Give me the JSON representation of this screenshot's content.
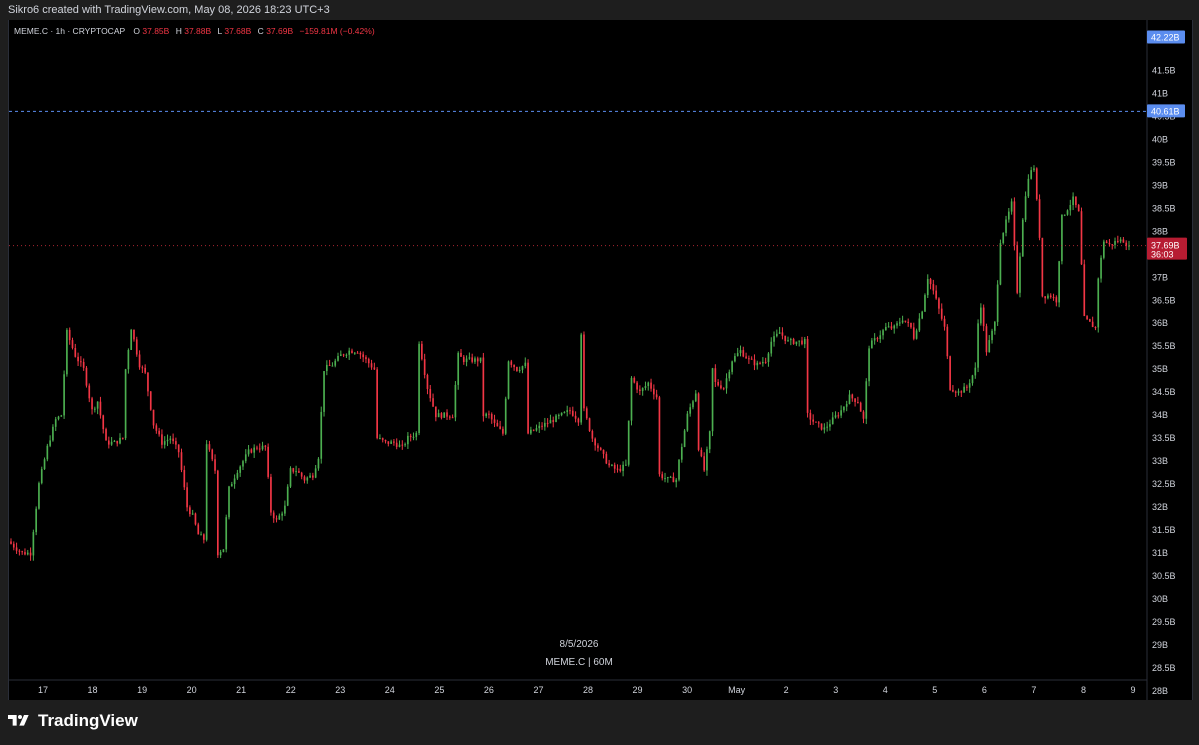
{
  "header": {
    "caption": "Sikro6 created with TradingView.com, May 08, 2026 18:23 UTC+3"
  },
  "legend": {
    "symbol": "MEME.C · 1h · CRYPTOCAP",
    "o_label": "O",
    "o_value": "37.85B",
    "h_label": "H",
    "h_value": "37.88B",
    "l_label": "L",
    "l_value": "37.68B",
    "c_label": "C",
    "c_value": "37.69B",
    "change": "−159.81M (−0.42%)"
  },
  "watermark": {
    "date": "8/5/2026",
    "symbol": "MEME.C | 60M"
  },
  "brand": {
    "name": "TradingView"
  },
  "colors": {
    "up": "#4caf50",
    "down": "#f23645",
    "background": "#000000",
    "axis_text": "#d1d4dc",
    "blue_line": "#5b8def",
    "price_badge": "#b71c32"
  },
  "chart_data": {
    "type": "candlestick",
    "timeframe": "1h",
    "symbol": "MEME.C",
    "y_unit": "B",
    "ylim": [
      27.8,
      42.6
    ],
    "y_ticks": [
      "28B",
      "28.5B",
      "29B",
      "29.5B",
      "30B",
      "30.5B",
      "31B",
      "31.5B",
      "32B",
      "32.5B",
      "33B",
      "33.5B",
      "34B",
      "34.5B",
      "35B",
      "35.5B",
      "36B",
      "36.5B",
      "37B",
      "37.5B",
      "38B",
      "38.5B",
      "39B",
      "39.5B",
      "40B",
      "40.5B",
      "41B",
      "41.5B"
    ],
    "y_tick_values": [
      28,
      28.5,
      29,
      29.5,
      30,
      30.5,
      31,
      31.5,
      32,
      32.5,
      33,
      33.5,
      34,
      34.5,
      35,
      35.5,
      36,
      36.5,
      37,
      37.5,
      38,
      38.5,
      39,
      39.5,
      40,
      40.5,
      41,
      41.5
    ],
    "x_ticks": [
      "17",
      "18",
      "19",
      "20",
      "21",
      "22",
      "23",
      "24",
      "25",
      "26",
      "27",
      "28",
      "29",
      "30",
      "May",
      "2",
      "3",
      "4",
      "5",
      "6",
      "7",
      "8",
      "9"
    ],
    "x_range": [
      "Apr 16 11:00",
      "May 9 02:00"
    ],
    "badges": [
      {
        "label": "42.22B",
        "value": 42.22,
        "style": "blue"
      },
      {
        "label": "40.61B",
        "value": 40.61,
        "style": "blue-line"
      },
      {
        "label": "37.69B",
        "sub": "36:03",
        "value": 37.69,
        "style": "last-price"
      }
    ],
    "close_path": [
      [
        0,
        31.2
      ],
      [
        4,
        31.0
      ],
      [
        7,
        31.0
      ],
      [
        10,
        32.5
      ],
      [
        13,
        33.3
      ],
      [
        16,
        33.9
      ],
      [
        18,
        34.0
      ],
      [
        20,
        35.8
      ],
      [
        23,
        35.3
      ],
      [
        26,
        35.0
      ],
      [
        29,
        34.1
      ],
      [
        31,
        34.3
      ],
      [
        34,
        33.4
      ],
      [
        37,
        33.4
      ],
      [
        40,
        33.5
      ],
      [
        41,
        35.0
      ],
      [
        43,
        35.9
      ],
      [
        46,
        35.1
      ],
      [
        48,
        34.9
      ],
      [
        51,
        33.8
      ],
      [
        54,
        33.4
      ],
      [
        57,
        33.5
      ],
      [
        60,
        33.2
      ],
      [
        63,
        32.0
      ],
      [
        65,
        31.8
      ],
      [
        67,
        31.4
      ],
      [
        69,
        31.3
      ],
      [
        70,
        33.4
      ],
      [
        73,
        32.8
      ],
      [
        74,
        31.0
      ],
      [
        76,
        31.1
      ],
      [
        78,
        32.4
      ],
      [
        81,
        32.8
      ],
      [
        85,
        33.2
      ],
      [
        88,
        33.3
      ],
      [
        91,
        33.3
      ],
      [
        93,
        31.9
      ],
      [
        95,
        31.7
      ],
      [
        98,
        32.0
      ],
      [
        100,
        32.8
      ],
      [
        102,
        32.8
      ],
      [
        105,
        32.6
      ],
      [
        108,
        32.7
      ],
      [
        110,
        33.1
      ],
      [
        112,
        35.0
      ],
      [
        115,
        35.1
      ],
      [
        118,
        35.3
      ],
      [
        121,
        35.4
      ],
      [
        124,
        35.4
      ],
      [
        127,
        35.2
      ],
      [
        130,
        35.0
      ],
      [
        131,
        33.5
      ],
      [
        134,
        33.4
      ],
      [
        137,
        33.4
      ],
      [
        140,
        33.3
      ],
      [
        142,
        33.5
      ],
      [
        145,
        33.6
      ],
      [
        146,
        35.6
      ],
      [
        149,
        34.6
      ],
      [
        152,
        34.0
      ],
      [
        155,
        34.0
      ],
      [
        158,
        34.0
      ],
      [
        160,
        35.3
      ],
      [
        162,
        35.2
      ],
      [
        165,
        35.2
      ],
      [
        168,
        35.2
      ],
      [
        169,
        34.0
      ],
      [
        171,
        34.0
      ],
      [
        173,
        33.8
      ],
      [
        176,
        33.6
      ],
      [
        178,
        35.2
      ],
      [
        181,
        35.0
      ],
      [
        184,
        35.1
      ],
      [
        185,
        33.6
      ],
      [
        188,
        33.7
      ],
      [
        191,
        33.8
      ],
      [
        194,
        33.9
      ],
      [
        197,
        34.0
      ],
      [
        200,
        34.1
      ],
      [
        203,
        33.9
      ],
      [
        204,
        35.8
      ],
      [
        205,
        34.1
      ],
      [
        208,
        33.5
      ],
      [
        211,
        33.2
      ],
      [
        214,
        32.9
      ],
      [
        217,
        32.8
      ],
      [
        220,
        32.9
      ],
      [
        222,
        34.8
      ],
      [
        225,
        34.5
      ],
      [
        228,
        34.7
      ],
      [
        231,
        34.4
      ],
      [
        232,
        32.7
      ],
      [
        235,
        32.6
      ],
      [
        238,
        32.6
      ],
      [
        239,
        33.0
      ],
      [
        242,
        34.0
      ],
      [
        245,
        34.5
      ],
      [
        246,
        33.3
      ],
      [
        248,
        32.8
      ],
      [
        250,
        33.6
      ],
      [
        251,
        35.0
      ],
      [
        252,
        34.7
      ],
      [
        255,
        34.6
      ],
      [
        258,
        35.2
      ],
      [
        261,
        35.4
      ],
      [
        264,
        35.2
      ],
      [
        267,
        35.1
      ],
      [
        270,
        35.2
      ],
      [
        272,
        35.6
      ],
      [
        275,
        35.8
      ],
      [
        278,
        35.6
      ],
      [
        281,
        35.6
      ],
      [
        284,
        35.6
      ],
      [
        285,
        34.0
      ],
      [
        288,
        33.8
      ],
      [
        291,
        33.7
      ],
      [
        294,
        33.9
      ],
      [
        297,
        34.1
      ],
      [
        300,
        34.4
      ],
      [
        303,
        34.3
      ],
      [
        305,
        33.9
      ],
      [
        307,
        35.5
      ],
      [
        310,
        35.7
      ],
      [
        313,
        35.9
      ],
      [
        316,
        35.9
      ],
      [
        319,
        36.1
      ],
      [
        322,
        35.9
      ],
      [
        323,
        35.7
      ],
      [
        326,
        36.3
      ],
      [
        328,
        37.0
      ],
      [
        330,
        36.7
      ],
      [
        332,
        36.3
      ],
      [
        334,
        35.9
      ],
      [
        336,
        34.6
      ],
      [
        339,
        34.5
      ],
      [
        342,
        34.6
      ],
      [
        345,
        35.0
      ],
      [
        346,
        36.0
      ],
      [
        347,
        36.4
      ],
      [
        349,
        35.4
      ],
      [
        352,
        36.0
      ],
      [
        354,
        37.8
      ],
      [
        356,
        38.2
      ],
      [
        358,
        38.6
      ],
      [
        360,
        36.7
      ],
      [
        362,
        38.3
      ],
      [
        364,
        39.2
      ],
      [
        366,
        39.4
      ],
      [
        368,
        37.9
      ],
      [
        369,
        36.6
      ],
      [
        372,
        36.6
      ],
      [
        374,
        36.5
      ],
      [
        376,
        38.3
      ],
      [
        378,
        38.5
      ],
      [
        380,
        38.7
      ],
      [
        382,
        38.4
      ],
      [
        384,
        36.1
      ],
      [
        386,
        36.0
      ],
      [
        388,
        35.9
      ],
      [
        389,
        37.0
      ],
      [
        391,
        37.8
      ],
      [
        393,
        37.7
      ],
      [
        396,
        37.8
      ],
      [
        398,
        37.8
      ],
      [
        400,
        37.69
      ]
    ],
    "last_close": 37.69
  }
}
